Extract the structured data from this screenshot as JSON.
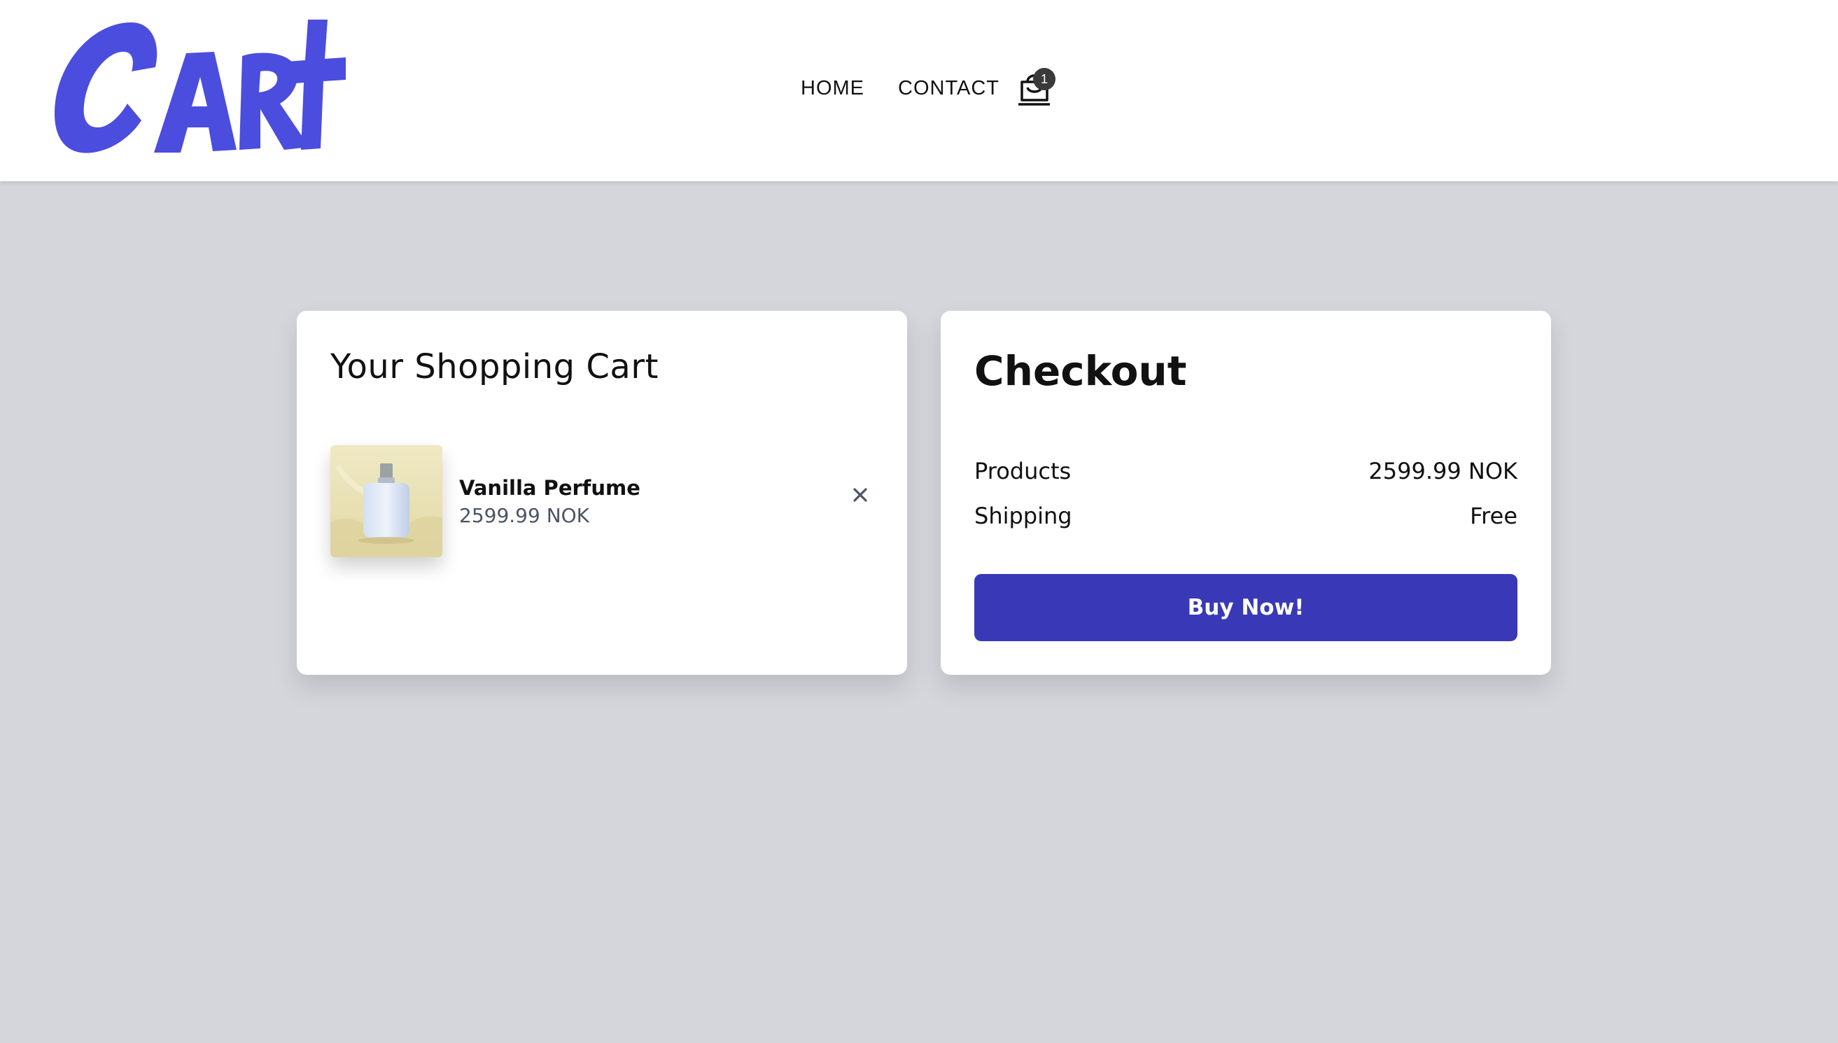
{
  "brand": {
    "logo_text": "CARt",
    "logo_color": "#4b4ddf"
  },
  "nav": {
    "items": [
      {
        "label": "HOME"
      },
      {
        "label": "CONTACT"
      }
    ],
    "cart_icon": "shopping-bag-icon",
    "cart_count": "1"
  },
  "cart": {
    "title": "Your Shopping Cart",
    "items": [
      {
        "name": "Vanilla Perfume",
        "price": "2599.99 NOK",
        "remove_icon": "close-icon"
      }
    ]
  },
  "checkout": {
    "title": "Checkout",
    "products_label": "Products",
    "products_value": "2599.99 NOK",
    "shipping_label": "Shipping",
    "shipping_value": "Free",
    "buy_label": "Buy Now!"
  },
  "colors": {
    "page_bg": "#d5d6dc",
    "accent": "#3939b8",
    "muted_text": "#4b5563"
  }
}
